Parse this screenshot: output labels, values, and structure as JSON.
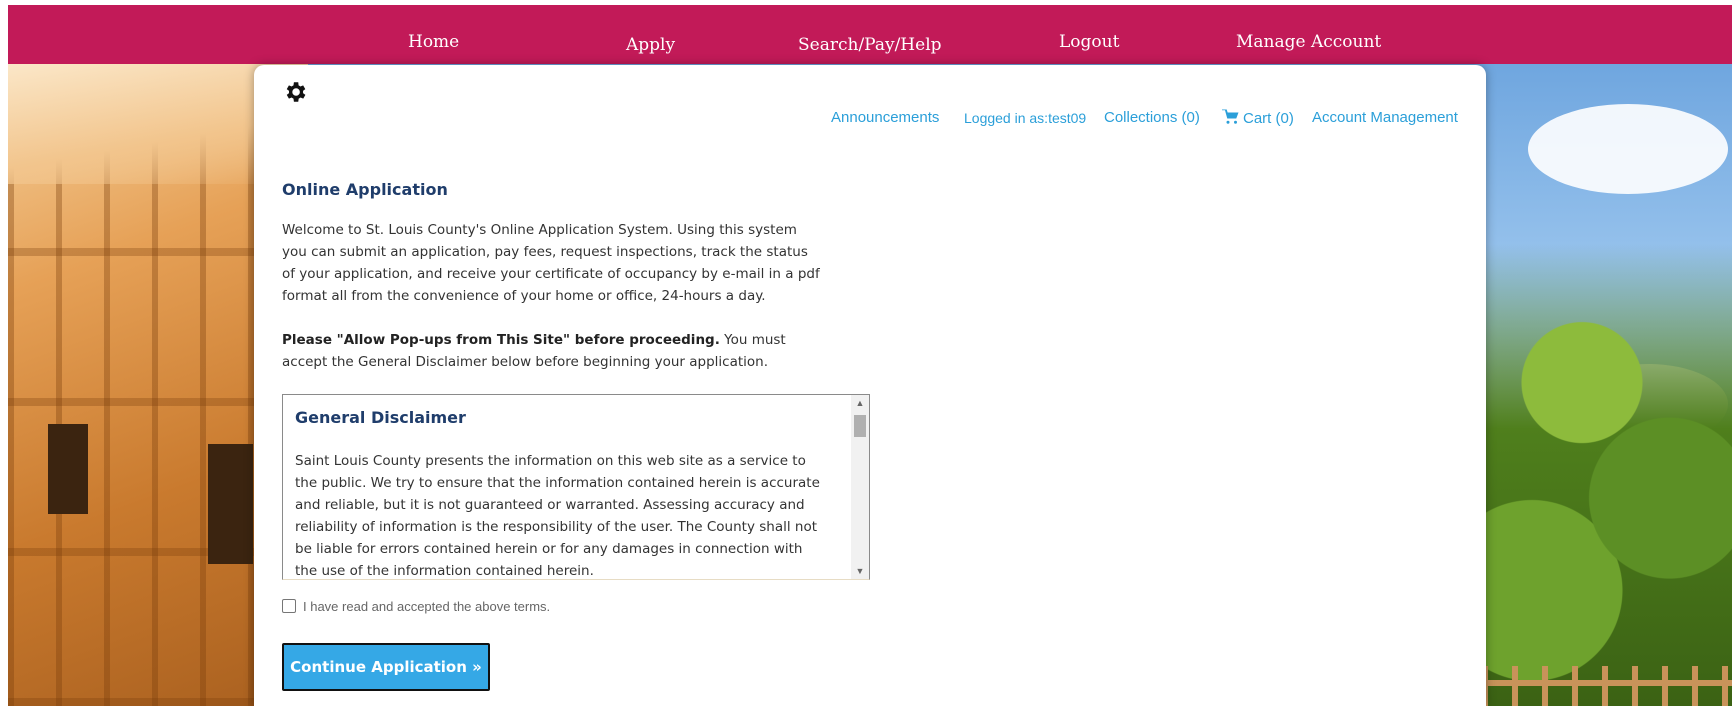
{
  "nav": {
    "items": [
      "Home",
      "Apply",
      "Search/Pay/Help",
      "Logout",
      "Manage Account"
    ]
  },
  "utility": {
    "announcements": "Announcements",
    "logged_in": "Logged in as:test09",
    "collections": "Collections (0)",
    "cart": "Cart (0)",
    "account_management": "Account Management"
  },
  "main": {
    "title": "Online Application",
    "intro": "Welcome to St. Louis County's Online Application System. Using this system you can submit an application, pay fees, request inspections, track the status of your application, and receive your certificate of occupancy by e-mail in a pdf format all from the convenience of your home or office, 24-hours a day.",
    "popup_bold": "Please \"Allow Pop-ups from This Site\" before proceeding.",
    "popup_rest": " You must accept the General Disclaimer below before beginning your application."
  },
  "disclaimer": {
    "title": "General Disclaimer",
    "body": "Saint Louis County presents the information on this web site as a service to the public. We try to ensure that the information contained herein is accurate and reliable, but it is not guaranteed or warranted. Assessing accuracy and reliability of information is the responsibility of the user. The County shall not be liable for errors contained herein or for any damages in connection with the use of the information contained herein."
  },
  "accept_label": "I have read and accepted the above terms.",
  "continue_label": "Continue Application »",
  "colors": {
    "nav_bg": "#c21a58",
    "link": "#2b9fd9",
    "heading": "#1f3d6b",
    "button": "#35a8e6"
  },
  "icons": [
    "gear-icon",
    "cart-icon",
    "scroll-up-icon",
    "scroll-down-icon"
  ]
}
